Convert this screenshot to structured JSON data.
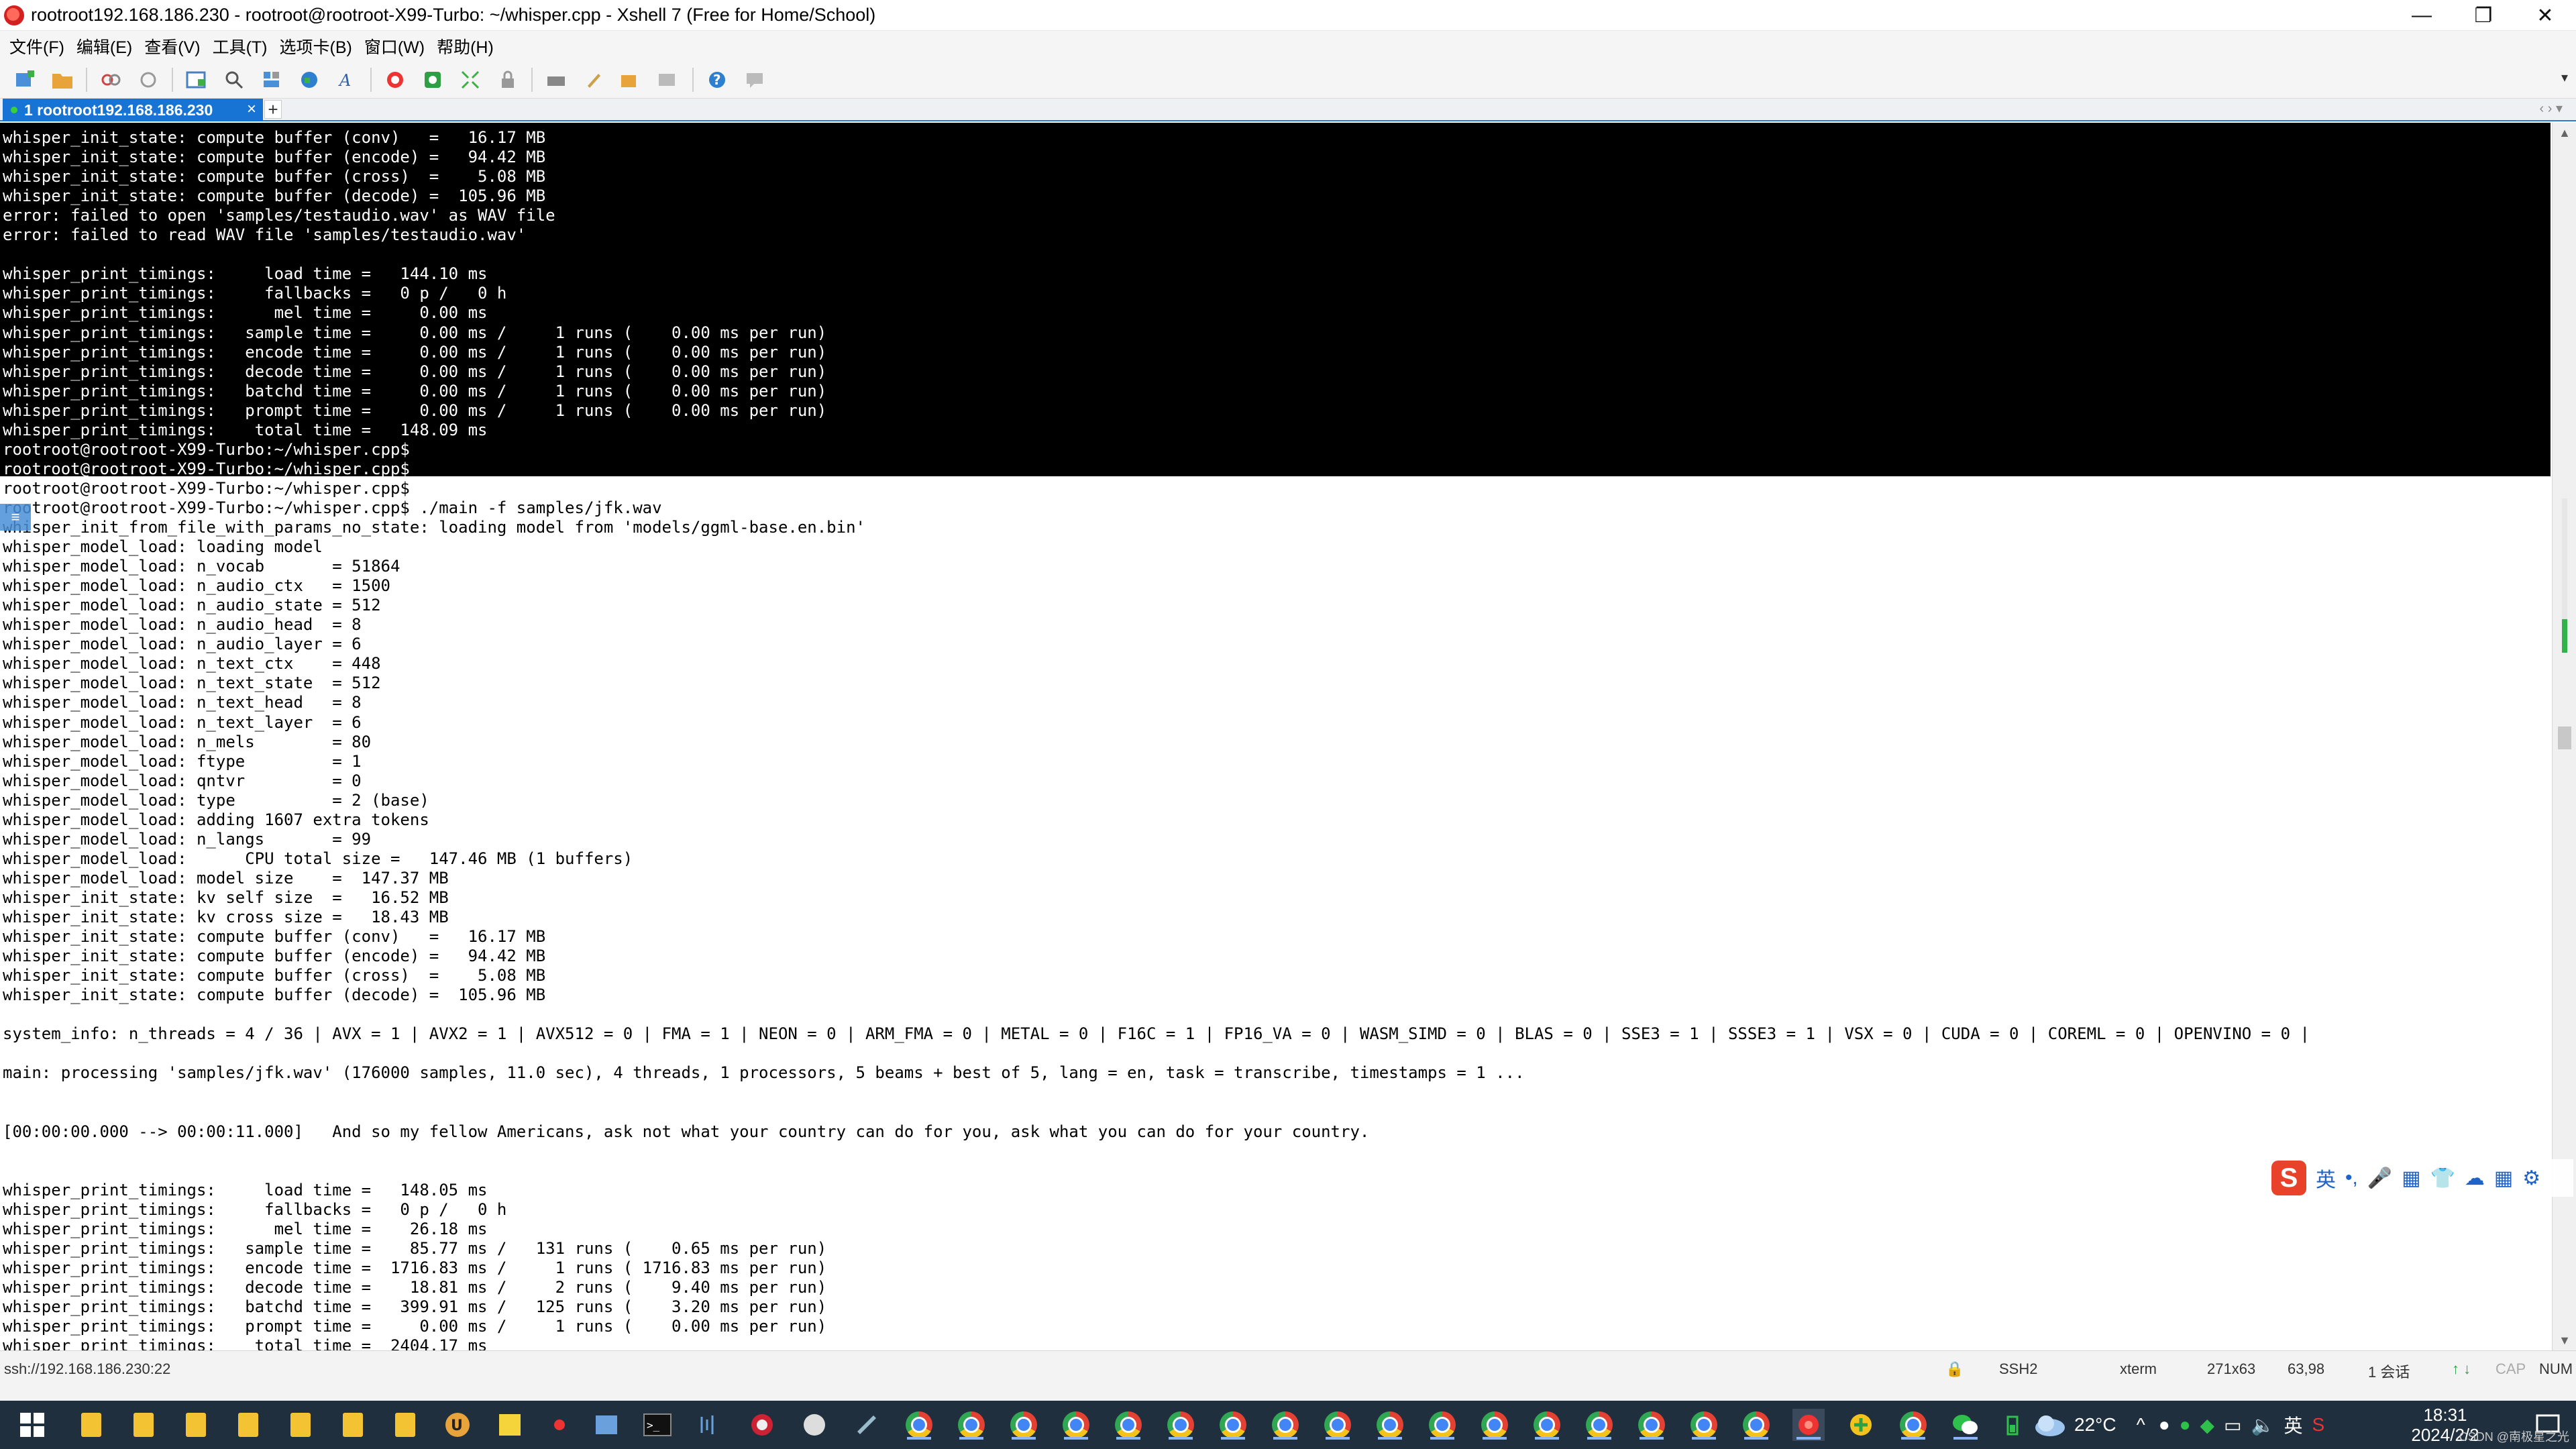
{
  "window": {
    "title": "rootroot192.168.186.230 - rootroot@rootroot-X99-Turbo: ~/whisper.cpp - Xshell 7 (Free for Home/School)",
    "controls": {
      "minimize": "—",
      "restore": "❐",
      "close": "✕"
    }
  },
  "menu": [
    "文件(F)",
    "编辑(E)",
    "查看(V)",
    "工具(T)",
    "选项卡(B)",
    "窗口(W)",
    "帮助(H)"
  ],
  "toolbar": {
    "icons": [
      "new-session-icon",
      "open-folder-icon",
      "disconnect-icon",
      "reconnect-icon",
      "new-window-icon",
      "find-icon",
      "layout-icon",
      "globe-icon",
      "font-icon",
      "xftp-icon",
      "xmanager-icon",
      "fullscreen-icon",
      "lock-icon",
      "keyboard-icon",
      "script-icon",
      "transfer-icon",
      "compose-icon",
      "help-icon",
      "chat-icon"
    ],
    "overflow": "▾"
  },
  "tab": {
    "label": "1 rootroot192.168.186.230",
    "close": "×",
    "add": "+",
    "nav": "‹ ›  ▾"
  },
  "terminal": {
    "top_lines": [
      "whisper_init_state: compute buffer (conv)   =   16.17 MB",
      "whisper_init_state: compute buffer (encode) =   94.42 MB",
      "whisper_init_state: compute buffer (cross)  =    5.08 MB",
      "whisper_init_state: compute buffer (decode) =  105.96 MB",
      "error: failed to open 'samples/testaudio.wav' as WAV file",
      "error: failed to read WAV file 'samples/testaudio.wav'",
      "",
      "whisper_print_timings:     load time =   144.10 ms",
      "whisper_print_timings:     fallbacks =   0 p /   0 h",
      "whisper_print_timings:      mel time =     0.00 ms",
      "whisper_print_timings:   sample time =     0.00 ms /     1 runs (    0.00 ms per run)",
      "whisper_print_timings:   encode time =     0.00 ms /     1 runs (    0.00 ms per run)",
      "whisper_print_timings:   decode time =     0.00 ms /     1 runs (    0.00 ms per run)",
      "whisper_print_timings:   batchd time =     0.00 ms /     1 runs (    0.00 ms per run)",
      "whisper_print_timings:   prompt time =     0.00 ms /     1 runs (    0.00 ms per run)",
      "whisper_print_timings:    total time =   148.09 ms",
      "rootroot@rootroot-X99-Turbo:~/whisper.cpp$",
      "rootroot@rootroot-X99-Turbo:~/whisper.cpp$"
    ],
    "bottom_lines": [
      "rootroot@rootroot-X99-Turbo:~/whisper.cpp$",
      "rootroot@rootroot-X99-Turbo:~/whisper.cpp$ ./main -f samples/jfk.wav",
      "whisper_init_from_file_with_params_no_state: loading model from 'models/ggml-base.en.bin'",
      "whisper_model_load: loading model",
      "whisper_model_load: n_vocab       = 51864",
      "whisper_model_load: n_audio_ctx   = 1500",
      "whisper_model_load: n_audio_state = 512",
      "whisper_model_load: n_audio_head  = 8",
      "whisper_model_load: n_audio_layer = 6",
      "whisper_model_load: n_text_ctx    = 448",
      "whisper_model_load: n_text_state  = 512",
      "whisper_model_load: n_text_head   = 8",
      "whisper_model_load: n_text_layer  = 6",
      "whisper_model_load: n_mels        = 80",
      "whisper_model_load: ftype         = 1",
      "whisper_model_load: qntvr         = 0",
      "whisper_model_load: type          = 2 (base)",
      "whisper_model_load: adding 1607 extra tokens",
      "whisper_model_load: n_langs       = 99",
      "whisper_model_load:      CPU total size =   147.46 MB (1 buffers)",
      "whisper_model_load: model size    =  147.37 MB",
      "whisper_init_state: kv self size  =   16.52 MB",
      "whisper_init_state: kv cross size =   18.43 MB",
      "whisper_init_state: compute buffer (conv)   =   16.17 MB",
      "whisper_init_state: compute buffer (encode) =   94.42 MB",
      "whisper_init_state: compute buffer (cross)  =    5.08 MB",
      "whisper_init_state: compute buffer (decode) =  105.96 MB",
      "",
      "system_info: n_threads = 4 / 36 | AVX = 1 | AVX2 = 1 | AVX512 = 0 | FMA = 1 | NEON = 0 | ARM_FMA = 0 | METAL = 0 | F16C = 1 | FP16_VA = 0 | WASM_SIMD = 0 | BLAS = 0 | SSE3 = 1 | SSSE3 = 1 | VSX = 0 | CUDA = 0 | COREML = 0 | OPENVINO = 0 |",
      "",
      "main: processing 'samples/jfk.wav' (176000 samples, 11.0 sec), 4 threads, 1 processors, 5 beams + best of 5, lang = en, task = transcribe, timestamps = 1 ...",
      "",
      "",
      "[00:00:00.000 --> 00:00:11.000]   And so my fellow Americans, ask not what your country can do for you, ask what you can do for your country.",
      "",
      "",
      "whisper_print_timings:     load time =   148.05 ms",
      "whisper_print_timings:     fallbacks =   0 p /   0 h",
      "whisper_print_timings:      mel time =    26.18 ms",
      "whisper_print_timings:   sample time =    85.77 ms /   131 runs (    0.65 ms per run)",
      "whisper_print_timings:   encode time =  1716.83 ms /     1 runs ( 1716.83 ms per run)",
      "whisper_print_timings:   decode time =    18.81 ms /     2 runs (    9.40 ms per run)",
      "whisper_print_timings:   batchd time =   399.91 ms /   125 runs (    3.20 ms per run)",
      "whisper_print_timings:   prompt time =     0.00 ms /     1 runs (    0.00 ms per run)",
      "whisper_print_timings:    total time =  2404.17 ms"
    ]
  },
  "ime": {
    "logo": "S",
    "mode": "英",
    "items": [
      "•,",
      "🎤",
      "▦",
      "👕",
      "☁",
      "▦",
      "⚙"
    ]
  },
  "status": {
    "address": "ssh://192.168.186.230:22",
    "protocol": "SSH2",
    "term": "xterm",
    "size": "271x63",
    "cursor": "63,98",
    "sessions": "1 会话",
    "caps": "CAP",
    "num": "NUM"
  },
  "taskbar": {
    "temp": "22°C",
    "lang": "英",
    "time": "18:31",
    "date": "2024/2/2",
    "watermark": "CSDN @南极星之光"
  }
}
